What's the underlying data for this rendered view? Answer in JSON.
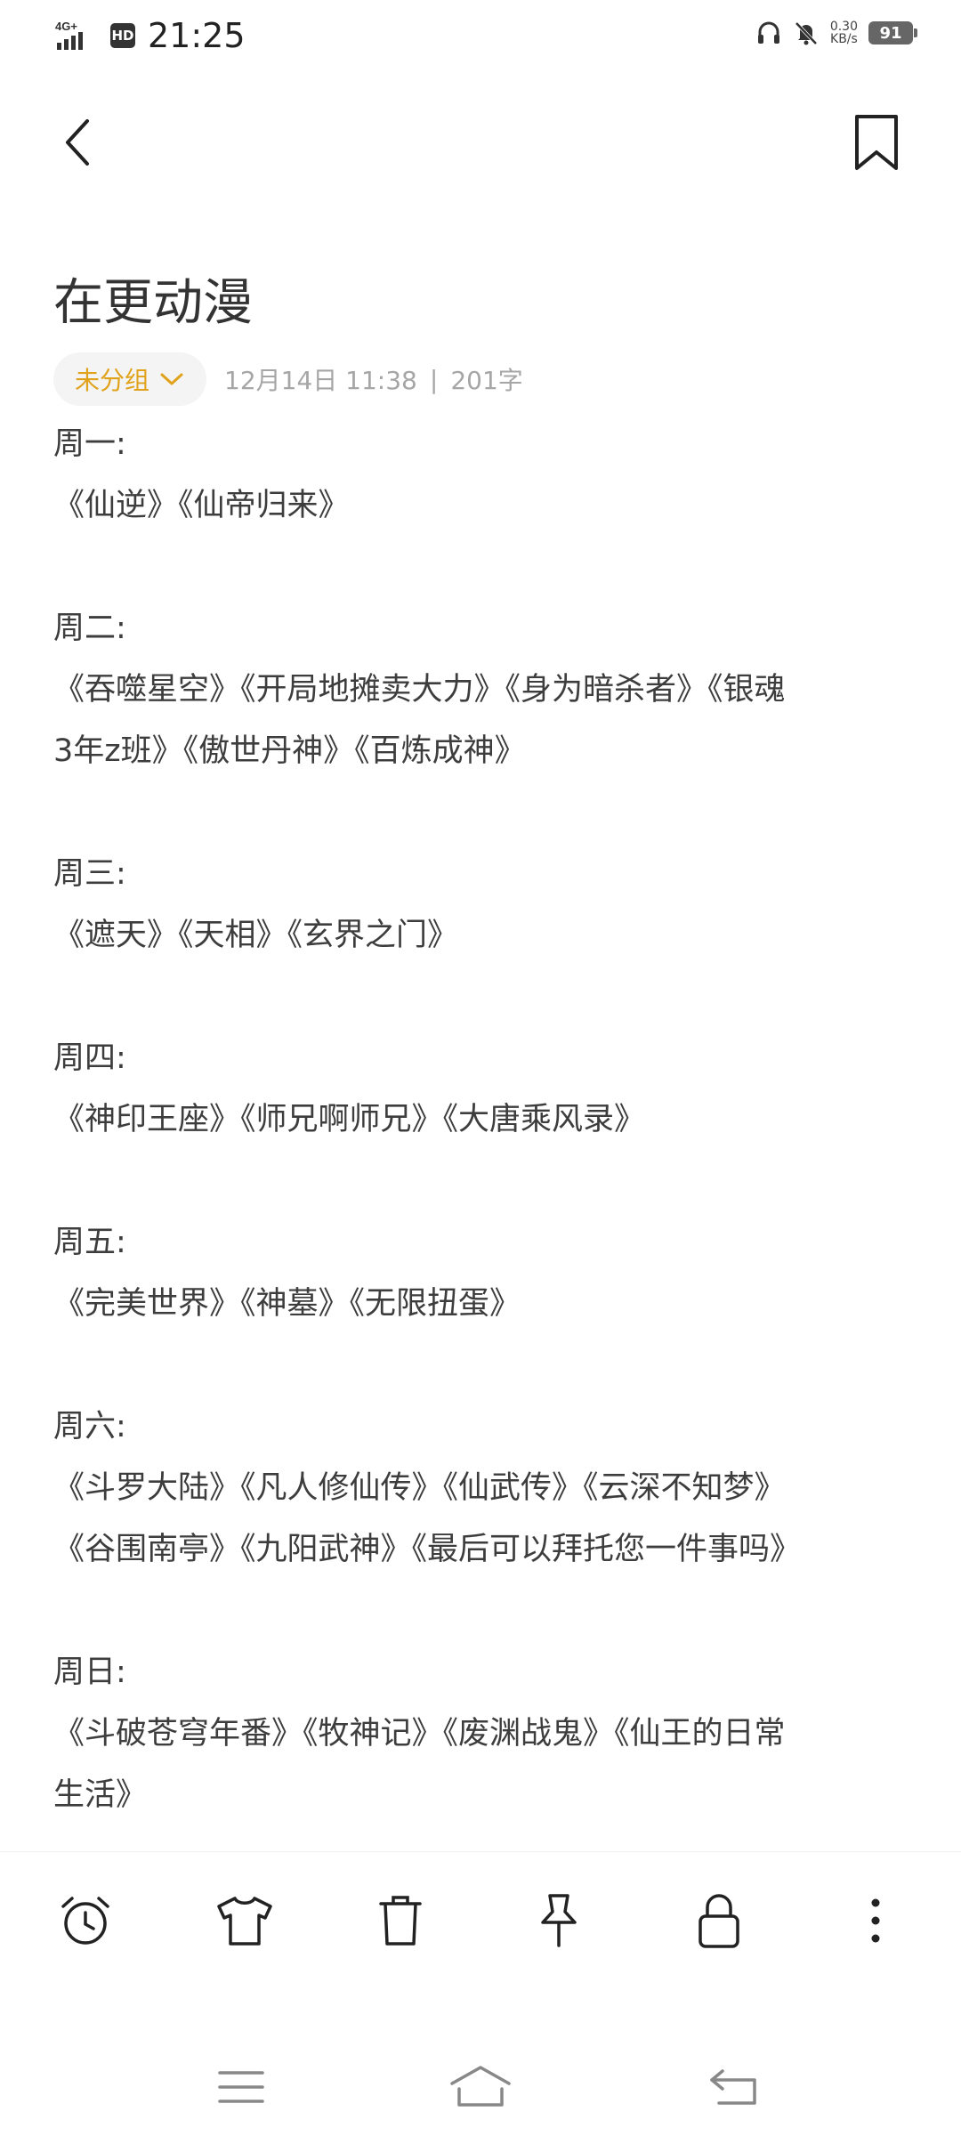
{
  "status_bar": {
    "network": "4G+",
    "hd_badge": "HD",
    "time": "21:25",
    "speed_value": "0.30",
    "speed_unit": "KB/s",
    "battery": "91",
    "icons": [
      "signal-icon",
      "headphones-icon",
      "bell-muted-icon"
    ]
  },
  "nav": {
    "back_icon": "chevron-left-icon",
    "bookmark_icon": "bookmark-icon"
  },
  "note": {
    "title": "在更动漫",
    "group_label": "未分组",
    "date": "12月14日 11:38",
    "separator": "|",
    "word_count": "201字",
    "accent_color": "#e0a21b",
    "lines": [
      "周一:",
      "《仙逆》《仙帝归来》",
      "",
      "周二:",
      "《吞噬星空》《开局地摊卖大力》《身为暗杀者》《银魂",
      "3年z班》《傲世丹神》《百炼成神》",
      "",
      "周三:",
      "《遮天》《天相》《玄界之门》",
      "",
      "周四:",
      "《神印王座》《师兄啊师兄》《大唐乘风录》",
      "",
      "周五:",
      "《完美世界》《神墓》《无限扭蛋》",
      "",
      "周六:",
      "《斗罗大陆》《凡人修仙传》《仙武传》《云深不知梦》",
      "《谷围南亭》《九阳武神》《最后可以拜托您一件事吗》",
      "",
      "周日:",
      "《斗破苍穹年番》《牧神记》《废渊战鬼》《仙王的日常",
      "生活》"
    ]
  },
  "toolbar": {
    "items": [
      "alarm-icon",
      "shirt-icon",
      "trash-icon",
      "pin-icon",
      "lock-icon",
      "more-vertical-icon"
    ]
  },
  "system_nav": {
    "items": [
      "menu-icon",
      "home-icon",
      "back-icon"
    ]
  }
}
